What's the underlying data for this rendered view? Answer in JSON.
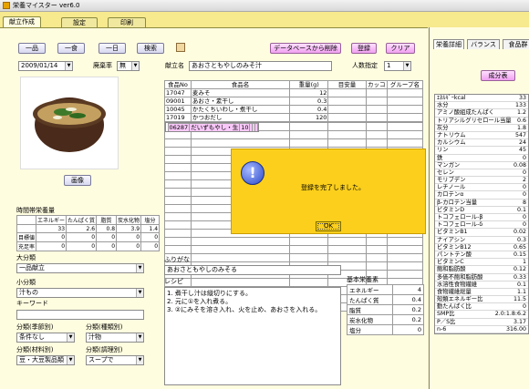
{
  "window": {
    "title": "栄養マイスター ver6.0"
  },
  "tabs": [
    "献立作成",
    "設定",
    "印刷"
  ],
  "toolbar": {
    "ichihin": "一品",
    "isshoku": "一食",
    "ichinichi": "一日",
    "search": "検索",
    "delete_db": "データベースから削除",
    "register": "登録",
    "clear": "クリア"
  },
  "date": "2009/01/14",
  "haikiritsu_label": "廃棄率",
  "haikiritsu_value": "無",
  "menu_name_label": "献立名",
  "menu_name": "あおさともやしのみそ汁",
  "servings_label": "人数指定",
  "servings": "1",
  "photo_button": "画像",
  "grid": {
    "headers": [
      "食品No",
      "食品名",
      "重量(g)",
      "目安量",
      "カッコ",
      "グループ名"
    ],
    "rows": [
      {
        "no": "17047",
        "name": "麦みそ",
        "weight": "12"
      },
      {
        "no": "09001",
        "name": "あおさ・素干し",
        "weight": "0.3"
      },
      {
        "no": "10045",
        "name": "かたくちいわし・煮干し",
        "weight": "0.4"
      },
      {
        "no": "17019",
        "name": "かつおだし",
        "weight": "120"
      },
      {
        "no": "06287",
        "name": "だいずもやし・生",
        "weight": "10"
      }
    ]
  },
  "time_nutrient": {
    "label": "時間帯栄養量",
    "headers": [
      "エネルギー",
      "たんぱく質",
      "脂質",
      "炭水化物",
      "塩分"
    ],
    "rows": [
      {
        "label": "",
        "values": [
          "33",
          "2.6",
          "0.8",
          "3.9",
          "1.4"
        ]
      },
      {
        "label": "目標値",
        "values": [
          "0",
          "0",
          "0",
          "0",
          "0"
        ]
      },
      {
        "label": "充足率",
        "values": [
          "0",
          "0",
          "0",
          "0",
          "0"
        ]
      }
    ]
  },
  "class_big_label": "大分類",
  "class_big": "一品献立",
  "class_small_label": "小分類",
  "class_small": "汁もの",
  "keyword_label": "キーワード",
  "season_label": "分類(季節別)",
  "season": "条件なし",
  "kind_label": "分類(種類別)",
  "kind": "汁物",
  "material_label": "分類(材料別)",
  "material": "豆・大豆製品類",
  "cooking_label": "分類(調理別)",
  "cooking": "スープで",
  "furigana_label": "ふりがな",
  "furigana": "あおさともやしのみそる",
  "recipe_label": "レシピ",
  "recipe": [
    "1. 煮干し汁は縦切りにする。",
    "2. 元に①を入れ煮る。",
    "3. ②にみそを溶き入れ、火を止め、あおさを入れる。"
  ],
  "basic_label": "基本栄養素",
  "basic": [
    {
      "name": "エネルギー",
      "value": "4"
    },
    {
      "name": "たんぱく質",
      "value": "0.4"
    },
    {
      "name": "脂質",
      "value": "0.2"
    },
    {
      "name": "炭水化物",
      "value": "0.2"
    },
    {
      "name": "塩分",
      "value": "0"
    }
  ],
  "dialog": {
    "message": "登録を完了しました。",
    "ok": "OK"
  },
  "right": {
    "tabs": [
      "栄養詳細",
      "バランス",
      "食品群"
    ],
    "btn": "成分表",
    "nutrients": [
      {
        "n": "ｴﾈﾙｷﾞｰkcal",
        "v": "33"
      },
      {
        "n": "水分",
        "v": "133"
      },
      {
        "n": "アミノ酸組成たんぱく",
        "v": "1.2"
      },
      {
        "n": "トリアシルグリセロール当量",
        "v": "0.6"
      },
      {
        "n": "灰分",
        "v": "1.8"
      },
      {
        "n": "ナトリウム",
        "v": "547"
      },
      {
        "n": "カルシウム",
        "v": "24"
      },
      {
        "n": "リン",
        "v": "45"
      },
      {
        "n": "鉄",
        "v": "0"
      },
      {
        "n": "マンガン",
        "v": "0.08"
      },
      {
        "n": "セレン",
        "v": "0"
      },
      {
        "n": "モリブデン",
        "v": "2"
      },
      {
        "n": "レチノール",
        "v": "0"
      },
      {
        "n": "カロテンα",
        "v": "0"
      },
      {
        "n": "β-カロテン当量",
        "v": "8"
      },
      {
        "n": "ビタミンD",
        "v": "0.1"
      },
      {
        "n": "トコフェロール-β",
        "v": "0"
      },
      {
        "n": "トコフェロール-δ",
        "v": "0"
      },
      {
        "n": "ビタミンB1",
        "v": "0.02"
      },
      {
        "n": "ナイアシン",
        "v": "0.3"
      },
      {
        "n": "ビタミンB12",
        "v": "0.65"
      },
      {
        "n": "パントテン酸",
        "v": "0.15"
      },
      {
        "n": "ビタミンC",
        "v": "1"
      },
      {
        "n": "飽和脂肪酸",
        "v": "0.12"
      },
      {
        "n": "多価不飽和脂肪酸",
        "v": "0.33"
      },
      {
        "n": "水溶性食物繊維",
        "v": "0.1"
      },
      {
        "n": "食物繊維総量",
        "v": "1.1"
      },
      {
        "n": "殻類エネルギー比",
        "v": "11.5"
      },
      {
        "n": "動たんぱく比",
        "v": "0"
      },
      {
        "n": "SMP比",
        "v": "2.0:1.8:6.2"
      },
      {
        "n": "P／S比",
        "v": "3.17"
      },
      {
        "n": "n-6",
        "v": "316.00"
      }
    ]
  }
}
